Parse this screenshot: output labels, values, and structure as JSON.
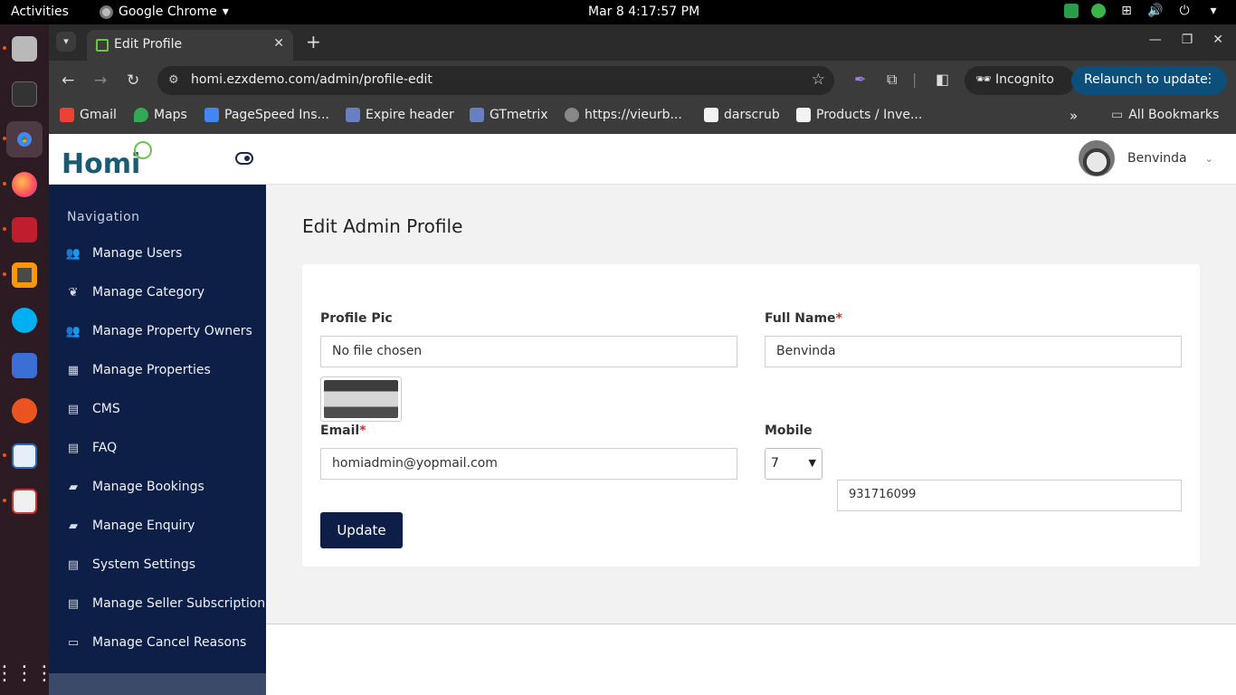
{
  "os": {
    "activities": "Activities",
    "app_name": "Google Chrome",
    "clock": "Mar 8  4:17:57 PM"
  },
  "browser": {
    "tab_title": "Edit Profile",
    "url": "homi.ezxdemo.com/admin/profile-edit",
    "incognito_label": "Incognito",
    "relaunch_label": "Relaunch to update",
    "bookmarks": [
      "Gmail",
      "Maps",
      "PageSpeed Ins...",
      "Expire header",
      "GTmetrix",
      "https://vieurb...",
      "darscrub",
      "Products / Inve..."
    ],
    "all_bookmarks": "All Bookmarks"
  },
  "header": {
    "logo_text": "Homi",
    "user_name": "Benvinda"
  },
  "sidebar": {
    "title": "Navigation",
    "items": [
      {
        "label": "Manage Users",
        "icon": "users-icon"
      },
      {
        "label": "Manage Category",
        "icon": "category-icon"
      },
      {
        "label": "Manage Property Owners",
        "icon": "users-icon"
      },
      {
        "label": "Manage Properties",
        "icon": "building-icon"
      },
      {
        "label": "CMS",
        "icon": "file-icon"
      },
      {
        "label": "FAQ",
        "icon": "file-icon"
      },
      {
        "label": "Manage Bookings",
        "icon": "book-icon"
      },
      {
        "label": "Manage Enquiry",
        "icon": "book-icon"
      },
      {
        "label": "System Settings",
        "icon": "file-icon"
      },
      {
        "label": "Manage Seller Subscription",
        "icon": "file-icon"
      },
      {
        "label": "Manage Cancel Reasons",
        "icon": "card-icon"
      }
    ]
  },
  "main": {
    "title": "Edit Admin Profile",
    "profile_pic_label": "Profile Pic",
    "file_value": "No file chosen",
    "full_name_label": "Full Name",
    "full_name_value": "Benvinda",
    "email_label": "Email",
    "email_value": "homiadmin@yopmail.com",
    "mobile_label": "Mobile",
    "mobile_code": "7",
    "mobile_value": "931716099",
    "required_mark": "*",
    "update_label": "Update"
  }
}
